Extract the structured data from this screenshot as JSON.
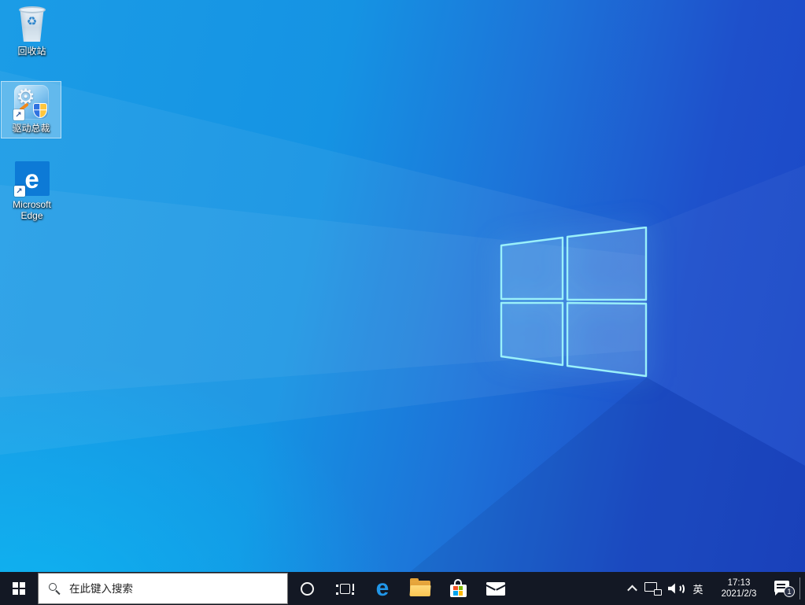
{
  "desktop": {
    "wallpaper": "windows-10-light-blue-logo",
    "icons": [
      {
        "name": "recycle-bin",
        "label": "回收站",
        "glyph": "♻",
        "selected": false
      },
      {
        "name": "driver-zongcai-shortcut",
        "label": "驱动总裁",
        "glyph": "⚙",
        "shortcut_arrow": "↗",
        "selected": true
      },
      {
        "name": "microsoft-edge-shortcut",
        "label": "Microsoft Edge",
        "glyph": "e",
        "shortcut_arrow": "↗",
        "selected": false
      }
    ]
  },
  "taskbar": {
    "start": {
      "name": "start-button",
      "icon": "windows-logo-icon"
    },
    "search": {
      "placeholder": "在此键入搜索",
      "icon": "search-icon"
    },
    "buttons": [
      {
        "name": "cortana",
        "icon": "cortana-circle-icon"
      },
      {
        "name": "task-view",
        "icon": "task-view-icon"
      },
      {
        "name": "microsoft-edge",
        "icon": "edge-e-icon",
        "glyph": "e"
      },
      {
        "name": "file-explorer",
        "icon": "folder-icon"
      },
      {
        "name": "microsoft-store",
        "icon": "store-bag-icon"
      },
      {
        "name": "mail",
        "icon": "envelope-icon"
      }
    ],
    "tray": {
      "hidden_icons_chevron": {
        "icon": "chevron-up-icon"
      },
      "network": {
        "icon": "network-ethernet-icon"
      },
      "volume": {
        "icon": "speaker-icon"
      },
      "language": "英",
      "clock": {
        "time": "17:13",
        "date": "2021/2/3"
      },
      "action_center": {
        "icon": "notification-bubble-icon",
        "badge": "1"
      }
    }
  },
  "colors": {
    "taskbar_bg": "#131824",
    "wallpaper_top_left": "#1e9ae4",
    "wallpaper_bottom_left": "#04adf0",
    "wallpaper_right": "#1b46c6",
    "logo_pane_border": "#9af0fa",
    "selection_fill": "rgba(255,255,255,0.28)",
    "store_logo": [
      "#f25022",
      "#7fba00",
      "#00a4ef",
      "#ffb900"
    ]
  }
}
